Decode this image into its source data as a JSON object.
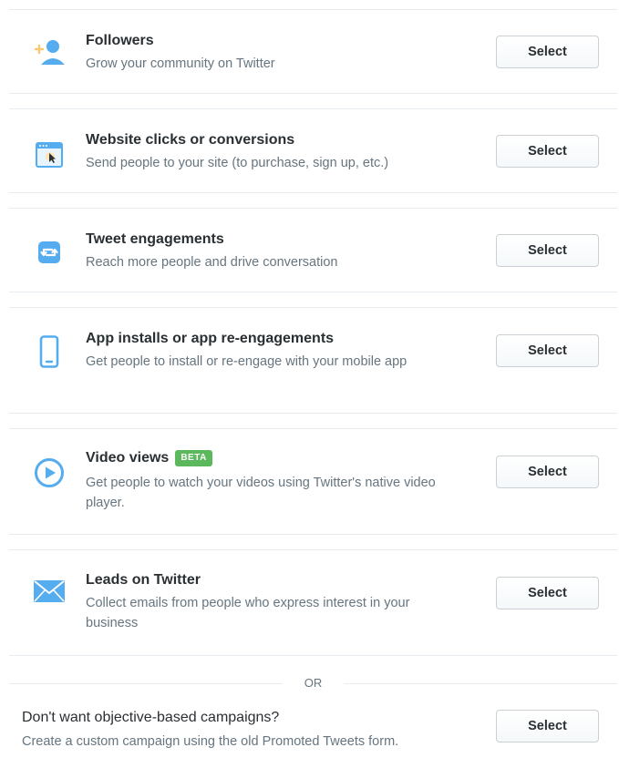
{
  "objectives": [
    {
      "title": "Followers",
      "description": "Grow your community on Twitter",
      "icon": "add-follower-icon",
      "button_label": "Select"
    },
    {
      "title": "Website clicks or conversions",
      "description": "Send people to your site (to purchase, sign up, etc.)",
      "icon": "browser-cursor-icon",
      "button_label": "Select"
    },
    {
      "title": "Tweet engagements",
      "description": "Reach more people and drive conversation",
      "icon": "retweet-icon",
      "button_label": "Select"
    },
    {
      "title": "App installs or app re-engagements",
      "description": "Get people to install or re-engage with your mobile app",
      "icon": "mobile-phone-icon",
      "button_label": "Select"
    },
    {
      "title": "Video views",
      "badge": "BETA",
      "description": "Get people to watch your videos using Twitter's native video player.",
      "icon": "play-icon",
      "button_label": "Select"
    },
    {
      "title": "Leads on Twitter",
      "description": "Collect emails from people who express interest in your business",
      "icon": "envelope-icon",
      "button_label": "Select"
    }
  ],
  "separator": "OR",
  "alternative": {
    "title": "Don't want objective-based campaigns?",
    "description": "Create a custom campaign using the old Promoted Tweets form.",
    "button_label": "Select"
  },
  "colors": {
    "accent": "#55acee",
    "beta_badge": "#5cb85c",
    "divider": "#e6ecf0"
  }
}
